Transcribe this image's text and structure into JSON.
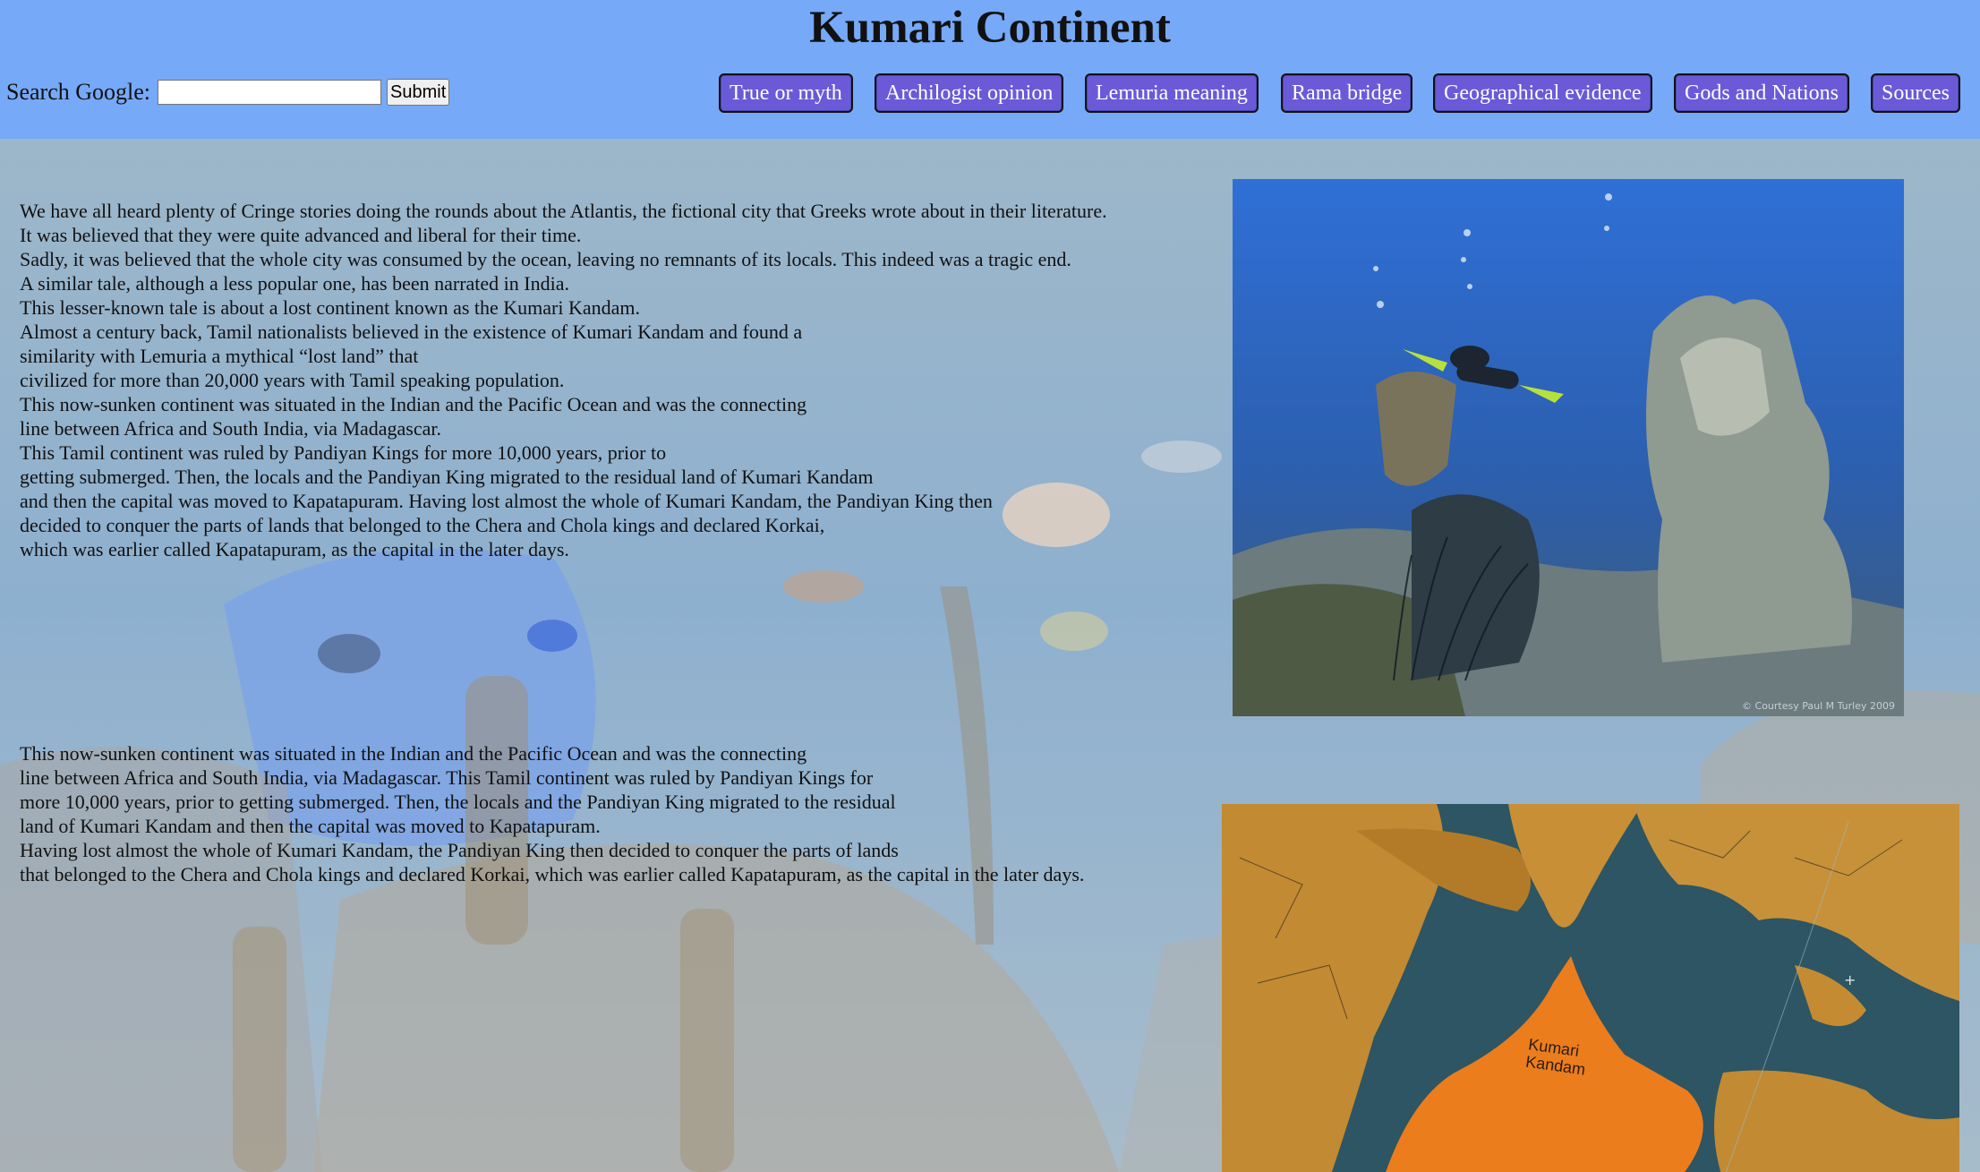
{
  "header": {
    "title": "Kumari Continent",
    "search_label": "Search Google:",
    "search_value": "",
    "submit_label": "Submit",
    "nav": [
      "True or myth",
      "Archilogist opinion",
      "Lemuria meaning",
      "Rama bridge",
      "Geographical evidence",
      "Gods and Nations",
      "Sources"
    ]
  },
  "content": {
    "paragraph1": [
      "We have all heard plenty of Cringe stories doing the rounds about the Atlantis, the fictional city that Greeks wrote about in their literature.",
      "It was believed that they were quite advanced and liberal for their time.",
      "Sadly, it was believed that the whole city was consumed by the ocean, leaving no remnants of its locals. This indeed was a tragic end.",
      "A similar tale, although a less popular one, has been narrated in India.",
      "This lesser-known tale is about a lost continent known as the Kumari Kandam.",
      "Almost a century back, Tamil nationalists believed in the existence of Kumari Kandam and found a",
      "similarity with Lemuria a mythical “lost land” that",
      "civilized for more than 20,000 years with Tamil speaking population.",
      "This now-sunken continent was situated in the Indian and the Pacific Ocean and was the connecting",
      "line between Africa and South India, via Madagascar.",
      "This Tamil continent was ruled by Pandiyan Kings for more 10,000 years, prior to",
      "getting submerged. Then, the locals and the Pandiyan King migrated to the residual land of Kumari Kandam",
      "and then the capital was moved to Kapatapuram. Having lost almost the whole of Kumari Kandam, the Pandiyan King then",
      "decided to conquer the parts of lands that belonged to the Chera and Chola kings and declared Korkai,",
      "which was earlier called Kapatapuram, as the capital in the later days."
    ],
    "paragraph2": [
      "This now-sunken continent was situated in the Indian and the Pacific Ocean and was the connecting",
      "line between Africa and South India, via Madagascar. This Tamil continent was ruled by Pandiyan Kings for",
      "more 10,000 years, prior to getting submerged. Then, the locals and the Pandiyan King migrated to the residual",
      "land of Kumari Kandam and then the capital was moved to Kapatapuram.",
      "Having lost almost the whole of Kumari Kandam, the Pandiyan King then decided to conquer the parts of lands",
      "that belonged to the Chera and Chola kings and declared Korkai, which was earlier called Kapatapuram, as the capital in the later days."
    ]
  },
  "images": {
    "photo1_credit": "© Courtesy Paul M Turley 2009",
    "map_label_1": "Kumari",
    "map_label_2": "Kandam"
  },
  "colors": {
    "header_bg": "#76a9f7",
    "nav_bg": "#6a5ad8",
    "nav_border": "#111111"
  }
}
